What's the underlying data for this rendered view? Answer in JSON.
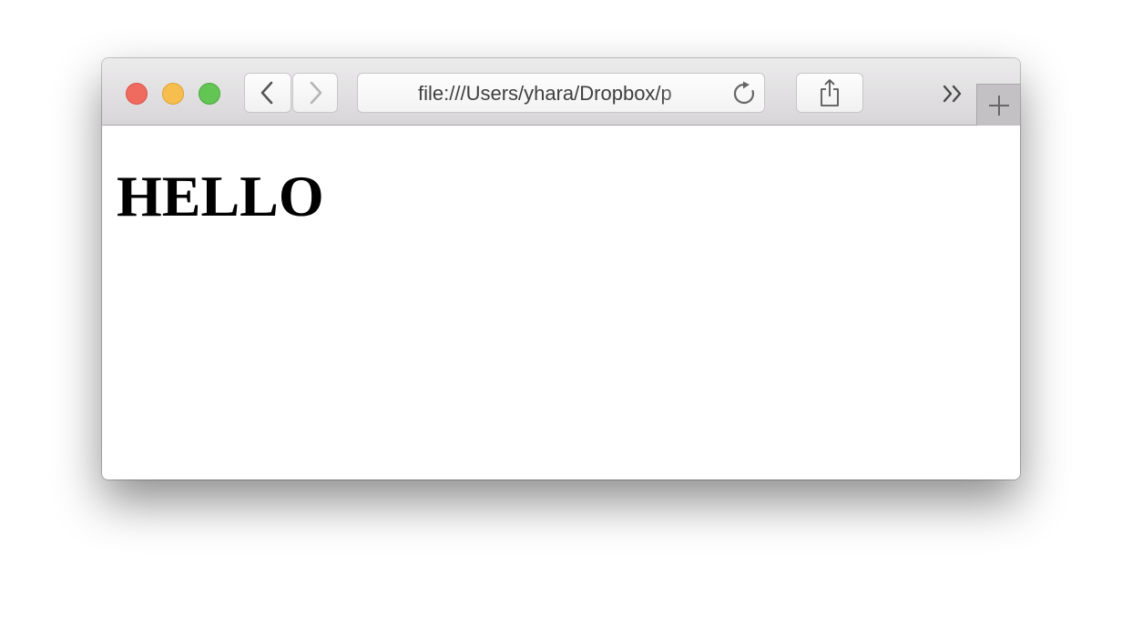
{
  "browser": {
    "address_bar": {
      "url": "file:///Users/yhara/Dropbox/p"
    }
  },
  "page": {
    "heading": "HELLO"
  },
  "icons": {
    "back": "chevron-left-icon",
    "forward": "chevron-right-icon",
    "reload": "reload-icon",
    "share": "share-icon",
    "overflow": "double-chevron-right-icon",
    "new_tab": "plus-icon"
  },
  "colors": {
    "close": "#ef6b5f",
    "minimize": "#f6be4f",
    "zoom": "#62c554",
    "toolbar": "#e2e0e2"
  }
}
